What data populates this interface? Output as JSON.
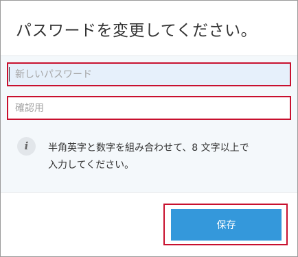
{
  "dialog": {
    "title": "パスワードを変更してください。"
  },
  "form": {
    "new_password": {
      "value": "",
      "placeholder": "新しいパスワード"
    },
    "confirm_password": {
      "value": "",
      "placeholder": "確認用"
    }
  },
  "info": {
    "icon": "info-icon",
    "glyph": "i",
    "line1": "半角英字と数字を組み合わせて、8 文字以上で",
    "line2": "入力してください。"
  },
  "footer": {
    "save_label": "保存"
  },
  "colors": {
    "accent": "#3498db",
    "highlight_border": "#c8102e",
    "body_background": "#f4f8fb",
    "active_field_background": "#e6f0fb"
  }
}
